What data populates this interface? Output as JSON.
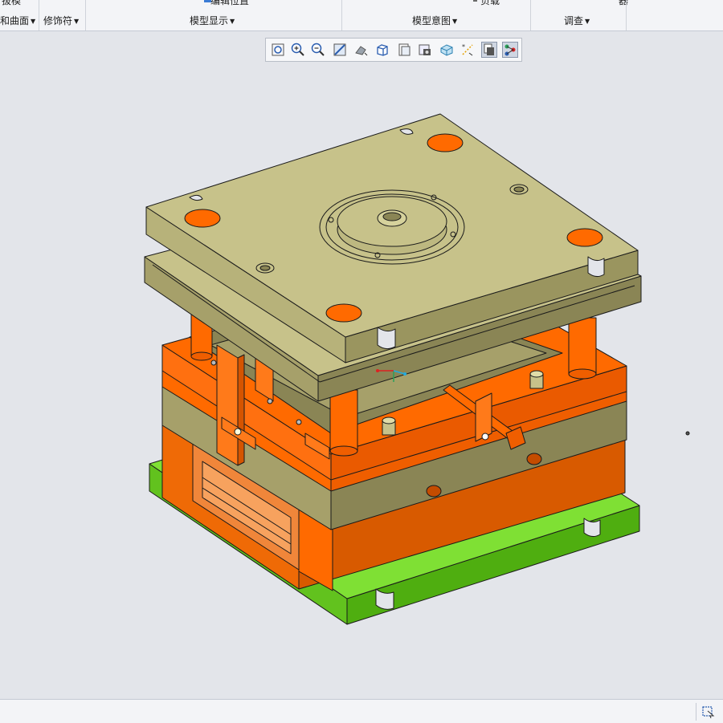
{
  "ribbon": {
    "cut_labels": [
      "拔模",
      "编辑位置",
      "负载",
      "器"
    ],
    "groups": [
      {
        "label": "和曲面"
      },
      {
        "label": "修饰符"
      },
      {
        "label": "模型显示"
      },
      {
        "label": "模型意图"
      },
      {
        "label": "调查"
      }
    ]
  },
  "graphics_toolbar": {
    "buttons": [
      {
        "icon": "refit-icon"
      },
      {
        "icon": "zoom-in-icon"
      },
      {
        "icon": "zoom-out-icon"
      },
      {
        "icon": "repaint-icon"
      },
      {
        "icon": "display-style-icon"
      },
      {
        "icon": "saved-orientations-icon"
      },
      {
        "icon": "view-manager-icon"
      },
      {
        "icon": "perspective-icon"
      },
      {
        "icon": "section-icon"
      },
      {
        "icon": "datum-display-icon"
      },
      {
        "icon": "annotation-display-icon"
      },
      {
        "icon": "spin-center-icon"
      }
    ]
  },
  "colors": {
    "plate_khaki": "#c7c28a",
    "plate_orange": "#ff6a00",
    "base_green": "#7fe034",
    "background": "#e3e5ea"
  },
  "status_bar": {
    "icon": "selection-filter-icon"
  }
}
